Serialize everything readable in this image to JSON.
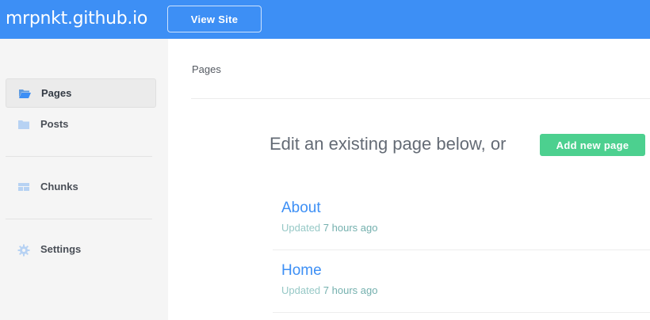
{
  "header": {
    "site_title": "mrpnkt.github.io",
    "view_site_label": "View Site",
    "bg_color": "#3d8ff5"
  },
  "sidebar": {
    "items": [
      {
        "label": "Pages",
        "icon": "folder-open-icon",
        "active": true
      },
      {
        "label": "Posts",
        "icon": "folder-icon",
        "active": false
      },
      {
        "label": "Chunks",
        "icon": "chunks-icon",
        "active": false
      },
      {
        "label": "Settings",
        "icon": "gear-icon",
        "active": false
      }
    ]
  },
  "main": {
    "breadcrumb": "Pages",
    "headline": "Edit an existing page below, or",
    "add_button_label": "Add new page",
    "add_button_color": "#4cd08f",
    "pages": [
      {
        "title": "About",
        "updated_prefix": "Updated",
        "updated_time": "7 hours ago"
      },
      {
        "title": "Home",
        "updated_prefix": "Updated",
        "updated_time": "7 hours ago"
      }
    ]
  }
}
